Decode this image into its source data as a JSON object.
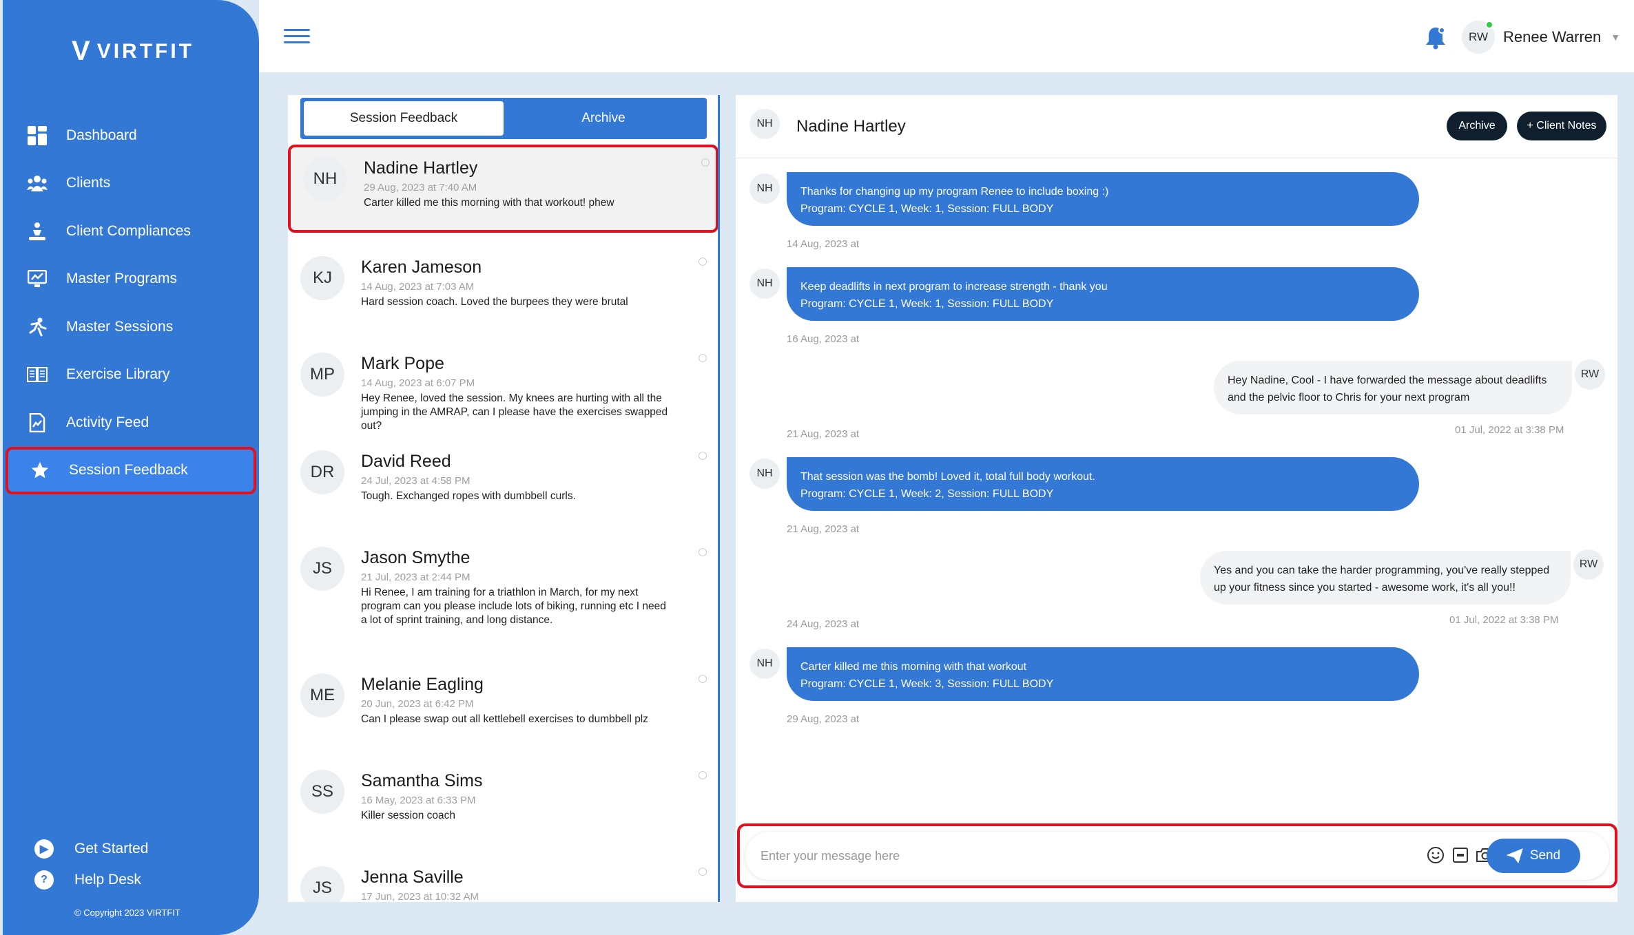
{
  "brand": {
    "name": "VIRTFIT"
  },
  "sidebar": {
    "items": [
      {
        "label": "Dashboard",
        "icon": "dashboard-icon"
      },
      {
        "label": "Clients",
        "icon": "clients-icon"
      },
      {
        "label": "Client Compliances",
        "icon": "compliance-icon"
      },
      {
        "label": "Master Programs",
        "icon": "programs-icon"
      },
      {
        "label": "Master Sessions",
        "icon": "sessions-icon"
      },
      {
        "label": "Exercise Library",
        "icon": "library-icon"
      },
      {
        "label": "Activity Feed",
        "icon": "activity-icon"
      },
      {
        "label": "Session Feedback",
        "icon": "star-icon",
        "active": true
      }
    ],
    "bottom": [
      {
        "label": "Get Started",
        "icon": "play-icon"
      },
      {
        "label": "Help Desk",
        "icon": "help-icon"
      }
    ],
    "copyright": "© Copyright 2023 VIRTFIT"
  },
  "topbar": {
    "user_initials": "RW",
    "user_name": "Renee Warren"
  },
  "list": {
    "tabs": [
      "Session Feedback",
      "Archive"
    ],
    "items": [
      {
        "initials": "NH",
        "name": "Nadine Hartley",
        "date": "29 Aug, 2023 at 7:40 AM",
        "message": "Carter killed me this morning with that workout! phew"
      },
      {
        "initials": "KJ",
        "name": "Karen Jameson",
        "date": "14 Aug, 2023 at 7:03 AM",
        "message": "Hard session coach. Loved the burpees they were brutal"
      },
      {
        "initials": "MP",
        "name": "Mark Pope",
        "date": "14 Aug, 2023 at 6:07 PM",
        "message": "Hey Renee, loved the session. My knees are hurting with all the jumping in the AMRAP, can I please have the exercises swapped out?"
      },
      {
        "initials": "DR",
        "name": "David Reed",
        "date": "24 Jul, 2023 at 4:58 PM",
        "message": "Tough. Exchanged ropes with dumbbell curls."
      },
      {
        "initials": "JS",
        "name": "Jason Smythe",
        "date": "21 Jul, 2023 at 2:44 PM",
        "message": "Hi Renee, I am training for a triathlon in March, for my next program can you please include lots of biking, running etc I need a lot of sprint training, and long distance."
      },
      {
        "initials": "ME",
        "name": "Melanie Eagling",
        "date": "20 Jun, 2023 at 6:42 PM",
        "message": "Can I please swap out all kettlebell exercises to dumbbell plz"
      },
      {
        "initials": "SS",
        "name": "Samantha Sims",
        "date": "16 May, 2023 at 6:33 PM",
        "message": "Killer session coach"
      },
      {
        "initials": "JS",
        "name": "Jenna Saville",
        "date": "17 Jun, 2023 at 10:32 AM",
        "message": ""
      }
    ]
  },
  "chat": {
    "client_initials": "NH",
    "client_name": "Nadine Hartley",
    "archive_label": "Archive",
    "notes_label": "+ Client Notes",
    "messages": [
      {
        "line1": "Thanks for changing up my program Renee to include boxing :)",
        "line2": "Program: CYCLE 1, Week: 1, Session: FULL BODY",
        "date": "14 Aug, 2023 at"
      },
      {
        "line1": "Keep deadlifts in next program to increase strength - thank you",
        "line2": "Program: CYCLE 1, Week: 1, Session: FULL BODY",
        "date": "16 Aug, 2023 at"
      },
      {
        "line1": "Hey Nadine, Cool - I have forwarded the message about deadlifts",
        "line2": "and the pelvic floor to Chris for your next program",
        "date_left": "21 Aug, 2023 at",
        "date_right": "01 Jul, 2022 at 3:38 PM",
        "initials": "RW"
      },
      {
        "line1": "That session was the bomb! Loved it, total full body workout.",
        "line2": "Program: CYCLE 1, Week: 2, Session: FULL BODY",
        "date": "21 Aug, 2023 at"
      },
      {
        "line1": "Yes and you can take the harder programming, you've really stepped",
        "line2": "up your fitness since you started - awesome work, it's all you!!",
        "date_left": "24 Aug, 2023 at",
        "date_right": "01 Jul, 2022 at 3:38 PM",
        "initials": "RW"
      },
      {
        "line1": "Carter killed me this morning with that workout",
        "line2": "Program: CYCLE 1, Week: 3, Session: FULL BODY",
        "date": "29 Aug, 2023 at"
      }
    ],
    "composer": {
      "placeholder": "Enter your message here",
      "send_label": "Send"
    }
  }
}
